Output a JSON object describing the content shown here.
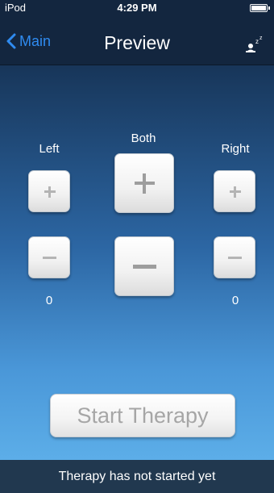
{
  "status_bar": {
    "carrier": "iPod",
    "time": "4:29 PM",
    "battery_level": 1.0
  },
  "nav": {
    "back_label": "Main",
    "title": "Preview",
    "back_icon": "chevron-left-icon",
    "right_icon": "sleep-icon"
  },
  "controls": {
    "left_label": "Left",
    "both_label": "Both",
    "right_label": "Right",
    "left_value": "0",
    "right_value": "0"
  },
  "start_button_label": "Start Therapy",
  "footer_status": "Therapy has not started yet",
  "colors": {
    "accent": "#2f8bf0",
    "nav_background": "#13263f",
    "footer_background": "#21384f",
    "button_symbol": "#b4b4b4"
  }
}
